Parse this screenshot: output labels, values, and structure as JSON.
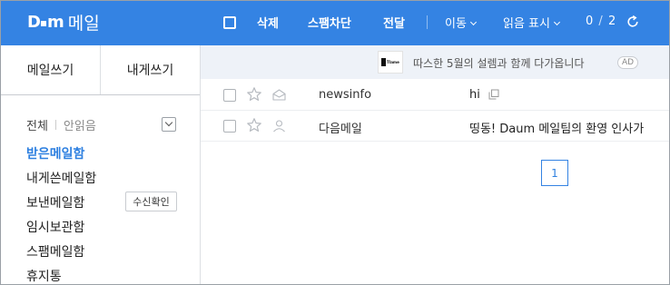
{
  "app": {
    "logo_mark": "D▪︎m",
    "logo_text": "메일"
  },
  "toolbar": {
    "delete": "삭제",
    "spam_block": "스팸차단",
    "forward": "전달",
    "move": "이동",
    "read_mark": "읽음 표시",
    "count_current": "0",
    "count_sep": "/",
    "count_total": "2"
  },
  "sidebar": {
    "compose": "메일쓰기",
    "compose_self": "내게쓰기",
    "filter_all": "전체",
    "filter_unread": "안읽음",
    "folders": [
      {
        "label": "받은메일함"
      },
      {
        "label": "내게쓴메일함"
      },
      {
        "label": "보낸메일함"
      },
      {
        "label": "임시보관함"
      },
      {
        "label": "스팸메일함"
      },
      {
        "label": "휴지통"
      }
    ],
    "receipt_check": "수신확인"
  },
  "ad": {
    "thumb_text": "TIame",
    "text": "따스한 5월의 설렘과 함께 다가옵니다",
    "badge": "AD"
  },
  "messages": [
    {
      "sender": "newsinfo",
      "subject": "hi",
      "starred": false,
      "read": false
    },
    {
      "sender": "다음메일",
      "subject": "띵동! Daum 메일팀의 환영 인사가",
      "starred": false,
      "read": true
    }
  ],
  "pagination": {
    "current": "1"
  },
  "colors": {
    "brand": "#3483e3",
    "active_folder": "#2e80e0"
  }
}
